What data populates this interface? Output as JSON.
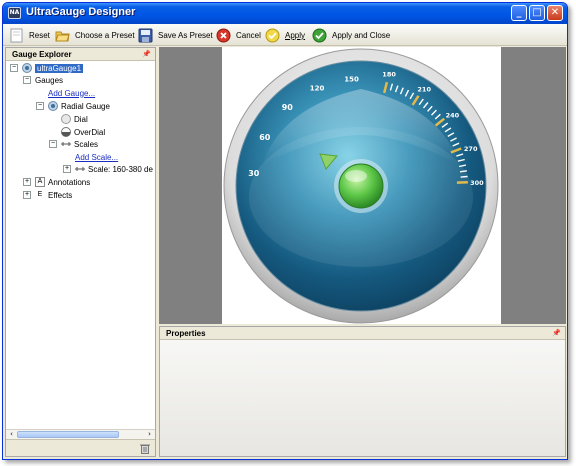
{
  "window": {
    "title": "UltraGauge Designer",
    "icon_label": "NA"
  },
  "toolbar": {
    "reset": "Reset",
    "choose_preset": "Choose a Preset",
    "save_preset": "Save As Preset",
    "cancel": "Cancel",
    "apply": "Apply",
    "apply_close": "Apply and Close"
  },
  "explorer": {
    "title": "Gauge Explorer",
    "pin": "📌",
    "root": "ultraGauge1",
    "gauges": "Gauges",
    "add_gauge": "Add Gauge...",
    "radial_gauge": "Radial Gauge",
    "dial": "Dial",
    "overdial": "OverDial",
    "scales": "Scales",
    "add_scale": "Add Scale...",
    "scale_item": "Scale: 160-380 de",
    "annotations": "Annotations",
    "effects": "Effects"
  },
  "gauge": {
    "labels": [
      "30",
      "60",
      "90",
      "120",
      "150",
      "180",
      "210",
      "240",
      "270",
      "300"
    ],
    "colors": {
      "accent": "#e2b94a",
      "face": "#1f6f95",
      "needle_cap": "#4fc24a",
      "marker": "#8fd26a"
    }
  },
  "properties": {
    "title": "Properties",
    "pin": "📌"
  },
  "icons": [
    "reset-icon",
    "folder-icon",
    "save-icon",
    "cancel-icon",
    "apply-icon",
    "apply-close-icon",
    "trash-icon"
  ]
}
